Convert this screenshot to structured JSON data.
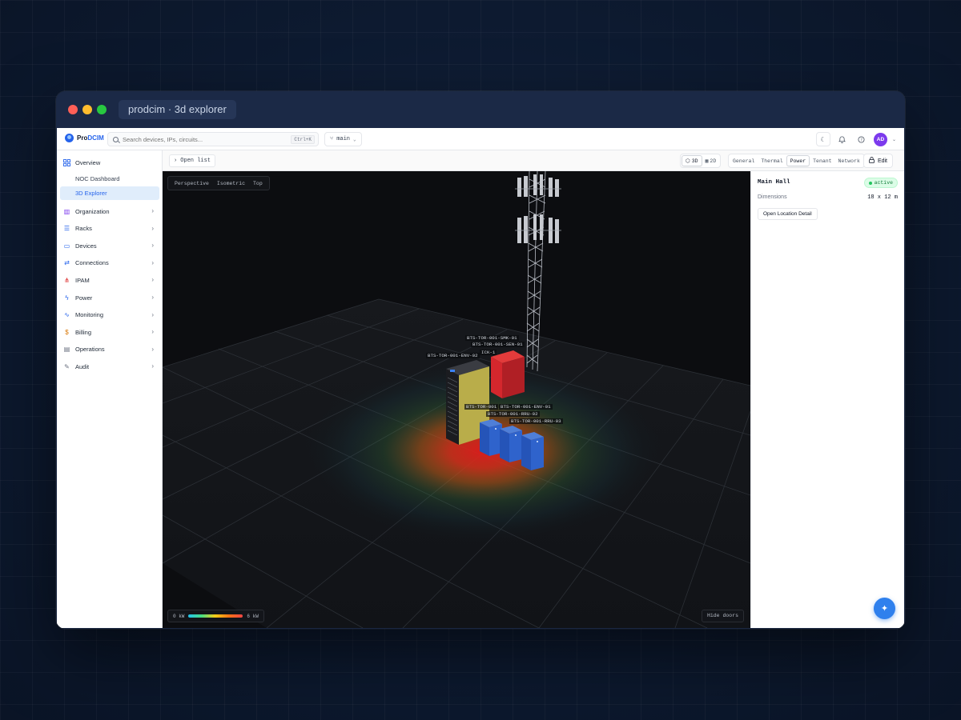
{
  "window": {
    "tab_title": "prodcim · 3d explorer"
  },
  "brand": {
    "name_part1": "Pro",
    "name_part2": "DCIM"
  },
  "search": {
    "placeholder": "Search devices, IPs, circuits...",
    "shortcut": "Ctrl+K"
  },
  "branch": {
    "label": "main"
  },
  "user": {
    "initials": "AD"
  },
  "sidebar": {
    "overview": "Overview",
    "sub_items": [
      "NOC Dashboard",
      "3D Explorer"
    ],
    "active_sub": "3D Explorer",
    "items": [
      {
        "label": "Organization",
        "icon": "building-icon",
        "color": "#7c3aed"
      },
      {
        "label": "Racks",
        "icon": "rack-icon",
        "color": "#2563eb"
      },
      {
        "label": "Devices",
        "icon": "device-icon",
        "color": "#2563eb"
      },
      {
        "label": "Connections",
        "icon": "connections-icon",
        "color": "#2563eb"
      },
      {
        "label": "IPAM",
        "icon": "network-icon",
        "color": "#dc2626"
      },
      {
        "label": "Power",
        "icon": "bolt-icon",
        "color": "#2563eb"
      },
      {
        "label": "Monitoring",
        "icon": "pulse-icon",
        "color": "#2563eb"
      },
      {
        "label": "Billing",
        "icon": "dollar-icon",
        "color": "#d97706"
      },
      {
        "label": "Operations",
        "icon": "clipboard-icon",
        "color": "#6b7280"
      },
      {
        "label": "Audit",
        "icon": "audit-icon",
        "color": "#6b7280"
      }
    ]
  },
  "toolbar": {
    "open_list": "Open list",
    "view_modes": [
      "3D",
      "2D"
    ],
    "active_view": "3D",
    "layers": [
      "General",
      "Thermal",
      "Power",
      "Tenant",
      "Network"
    ],
    "active_layer": "Power",
    "edit_label": "Edit"
  },
  "viewport": {
    "camera_modes": [
      "Perspective",
      "Isometric",
      "Top"
    ],
    "legend_min": "0 kW",
    "legend_max": "6 kW",
    "hide_doors": "Hide doors",
    "device_labels": [
      "BTS-TOR-001-SMK-01",
      "BTS-TOR-001-SEN-01",
      "ICK-1",
      "BTS-TOR-001-ENV-02",
      "BTS-TOR-001",
      "BTS-TOR-001-ENV-01",
      "BTS-TOR-001-RRU-02",
      "BTS-TOR-001-RRU-03"
    ]
  },
  "panel": {
    "title": "Main Hall",
    "status": "active",
    "dimensions_label": "Dimensions",
    "dimensions_value": "18 x 12 m",
    "location_button": "Open Location Detail"
  }
}
